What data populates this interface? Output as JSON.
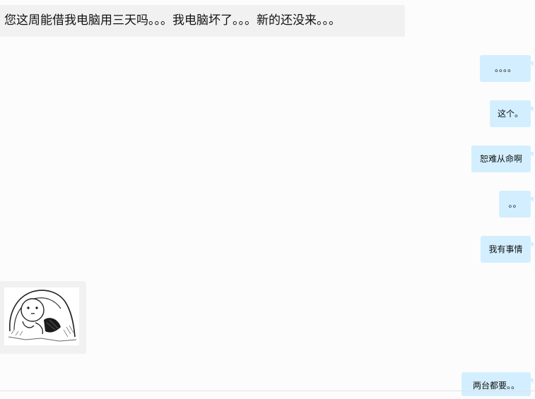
{
  "messages": [
    {
      "side": "left",
      "type": "text",
      "text": "您这周能借我电脑用三天吗。。。我电脑坏了。。。新的还没来。。。"
    },
    {
      "side": "right",
      "type": "text",
      "text": "。。。。"
    },
    {
      "side": "right",
      "type": "text",
      "text": "这个。"
    },
    {
      "side": "right",
      "type": "text",
      "text": "恕难从命啊"
    },
    {
      "side": "right",
      "type": "text",
      "text": "。。"
    },
    {
      "side": "right",
      "type": "text",
      "text": "我有事情"
    },
    {
      "side": "left",
      "type": "sticker",
      "icon": "sad-blob-sticker-icon"
    },
    {
      "side": "right",
      "type": "text",
      "text": "两台都要。。"
    }
  ],
  "colors": {
    "background": "#fcfcfc",
    "left_bubble": "#f1f1f1",
    "right_bubble": "#d3efff"
  }
}
